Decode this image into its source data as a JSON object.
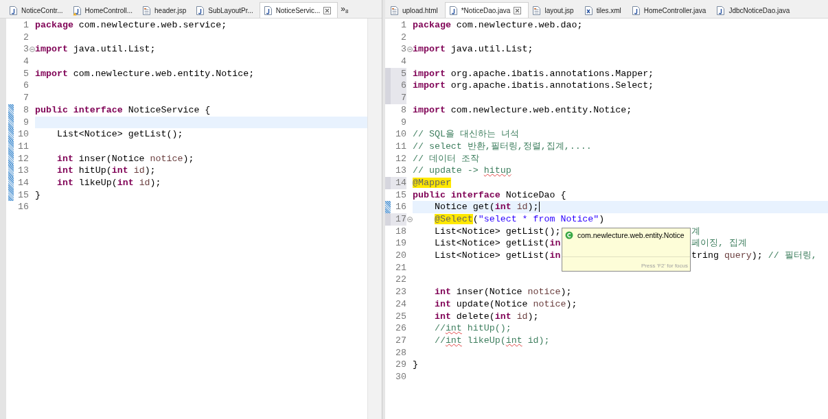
{
  "editors": [
    {
      "tabs": [
        {
          "label": "NoticeContr...",
          "kind": "java",
          "selected": false
        },
        {
          "label": "HomeControll...",
          "kind": "java-warning",
          "selected": false
        },
        {
          "label": "header.jsp",
          "kind": "web",
          "selected": false
        },
        {
          "label": "SubLayoutPr...",
          "kind": "java",
          "selected": false
        },
        {
          "label": "NoticeServic...",
          "kind": "java",
          "selected": true
        }
      ],
      "overflow": {
        "label": "»",
        "count": "8"
      },
      "lines": [
        {
          "number": "1",
          "tokens": [
            {
              "kind": "keyword",
              "text": "package "
            },
            {
              "kind": "plain",
              "text": "com.newlecture.web.service;"
            }
          ]
        },
        {
          "number": "2"
        },
        {
          "number": "3",
          "fold": true,
          "tokens": [
            {
              "kind": "keyword",
              "text": "import "
            },
            {
              "kind": "plain",
              "text": "java.util.List;"
            }
          ]
        },
        {
          "number": "4"
        },
        {
          "number": "5",
          "tokens": [
            {
              "kind": "keyword",
              "text": "import "
            },
            {
              "kind": "plain",
              "text": "com.newlecture.web.entity.Notice;"
            }
          ]
        },
        {
          "number": "6"
        },
        {
          "number": "7"
        },
        {
          "number": "8",
          "added": true,
          "tokens": [
            {
              "kind": "keyword",
              "text": "public interface "
            },
            {
              "kind": "plain",
              "text": "NoticeService {"
            }
          ]
        },
        {
          "number": "9",
          "added": true,
          "current": true
        },
        {
          "number": "10",
          "added": true,
          "tokens": [
            {
              "kind": "plain",
              "text": "    List<Notice> getList();"
            }
          ]
        },
        {
          "number": "11",
          "added": true
        },
        {
          "number": "12",
          "added": true,
          "tokens": [
            {
              "kind": "keyword",
              "text": "    int "
            },
            {
              "kind": "plain",
              "text": "inser(Notice "
            },
            {
              "kind": "param",
              "text": "notice"
            },
            {
              "kind": "plain",
              "text": ");"
            }
          ]
        },
        {
          "number": "13",
          "added": true,
          "tokens": [
            {
              "kind": "keyword",
              "text": "    int "
            },
            {
              "kind": "plain",
              "text": "hitUp("
            },
            {
              "kind": "keyword",
              "text": "int "
            },
            {
              "kind": "param",
              "text": "id"
            },
            {
              "kind": "plain",
              "text": ");"
            }
          ]
        },
        {
          "number": "14",
          "added": true,
          "tokens": [
            {
              "kind": "keyword",
              "text": "    int "
            },
            {
              "kind": "plain",
              "text": "likeUp("
            },
            {
              "kind": "keyword",
              "text": "int "
            },
            {
              "kind": "param",
              "text": "id"
            },
            {
              "kind": "plain",
              "text": ");"
            }
          ]
        },
        {
          "number": "15",
          "added": true,
          "tokens": [
            {
              "kind": "plain",
              "text": "}"
            }
          ]
        },
        {
          "number": "16"
        }
      ]
    },
    {
      "tabs": [
        {
          "label": "upload.html",
          "kind": "web",
          "selected": false
        },
        {
          "label": "*NoticeDao.java",
          "kind": "java",
          "selected": true
        },
        {
          "label": "layout.jsp",
          "kind": "web",
          "selected": false
        },
        {
          "label": "tiles.xml",
          "kind": "xml",
          "selected": false
        },
        {
          "label": "HomeController.java",
          "kind": "java",
          "selected": false
        },
        {
          "label": "JdbcNoticeDao.java",
          "kind": "java",
          "selected": false
        }
      ],
      "lines": [
        {
          "number": "1",
          "tokens": [
            {
              "kind": "keyword",
              "text": "package "
            },
            {
              "kind": "plain",
              "text": "com.newlecture.web.dao;"
            }
          ]
        },
        {
          "number": "2"
        },
        {
          "number": "3",
          "fold": true,
          "tokens": [
            {
              "kind": "keyword",
              "text": "import "
            },
            {
              "kind": "plain",
              "text": "java.util.List;"
            }
          ]
        },
        {
          "number": "4"
        },
        {
          "number": "5",
          "modified": true,
          "tokens": [
            {
              "kind": "keyword",
              "text": "import "
            },
            {
              "kind": "plain",
              "text": "org.apache.ibatis.annotations.Mapper;"
            }
          ]
        },
        {
          "number": "6",
          "modified": true,
          "tokens": [
            {
              "kind": "keyword",
              "text": "import "
            },
            {
              "kind": "plain",
              "text": "org.apache.ibatis.annotations.Select;"
            }
          ]
        },
        {
          "number": "7",
          "modified": true
        },
        {
          "number": "8",
          "tokens": [
            {
              "kind": "keyword",
              "text": "import "
            },
            {
              "kind": "plain",
              "text": "com.newlecture.web.entity.Notice;"
            }
          ]
        },
        {
          "number": "9"
        },
        {
          "number": "10",
          "tokens": [
            {
              "kind": "comment",
              "text": "// SQL을 대신하는 녀석"
            }
          ]
        },
        {
          "number": "11",
          "tokens": [
            {
              "kind": "comment",
              "text": "// select 반환,필터링,정렬,집계,...."
            }
          ]
        },
        {
          "number": "12",
          "tokens": [
            {
              "kind": "comment",
              "text": "// 데이터 조작"
            }
          ]
        },
        {
          "number": "13",
          "tokens": [
            {
              "kind": "comment",
              "text": "// update -> "
            },
            {
              "kind": "comment",
              "text": "hitup",
              "misspelled": true
            }
          ]
        },
        {
          "number": "14",
          "modified": true,
          "tokens": [
            {
              "kind": "annotation",
              "text": "@Mapper",
              "marked": true
            }
          ]
        },
        {
          "number": "15",
          "tokens": [
            {
              "kind": "keyword",
              "text": "public interface "
            },
            {
              "kind": "plain",
              "text": "NoticeDao {"
            }
          ]
        },
        {
          "number": "16",
          "added": true,
          "current": true,
          "caret": true,
          "tokens": [
            {
              "kind": "plain",
              "text": "    Notice get("
            },
            {
              "kind": "keyword",
              "text": "int "
            },
            {
              "kind": "param",
              "text": "id"
            },
            {
              "kind": "plain",
              "text": ");"
            }
          ]
        },
        {
          "number": "17",
          "modified": true,
          "fold": true,
          "tokens": [
            {
              "kind": "annotation",
              "text": "    @Select",
              "marked": true
            },
            {
              "kind": "plain",
              "text": "("
            },
            {
              "kind": "string",
              "text": "\"select * from Notice\""
            },
            {
              "kind": "plain",
              "text": ")"
            }
          ]
        },
        {
          "number": "18",
          "tokens": [
            {
              "kind": "plain",
              "text": "    List<Notice> getList();"
            }
          ],
          "tail": [
            {
              "kind": "comment",
              "text": "계"
            }
          ]
        },
        {
          "number": "19",
          "tokens": [
            {
              "kind": "plain",
              "text": "    List<Notice> getList("
            },
            {
              "kind": "keyword",
              "text": "in"
            }
          ],
          "tail": [
            {
              "kind": "comment",
              "text": "페이징, 집계"
            }
          ]
        },
        {
          "number": "20",
          "tokens": [
            {
              "kind": "plain",
              "text": "    List<Notice> getList("
            },
            {
              "kind": "keyword",
              "text": "in"
            }
          ],
          "tail": [
            {
              "kind": "plain",
              "text": "tring "
            },
            {
              "kind": "param",
              "text": "query"
            },
            {
              "kind": "plain",
              "text": "); "
            },
            {
              "kind": "comment",
              "text": "// 필터링,"
            }
          ]
        },
        {
          "number": "21"
        },
        {
          "number": "22"
        },
        {
          "number": "23",
          "tokens": [
            {
              "kind": "keyword",
              "text": "    int "
            },
            {
              "kind": "plain",
              "text": "inser(Notice "
            },
            {
              "kind": "param",
              "text": "notice"
            },
            {
              "kind": "plain",
              "text": ");"
            }
          ]
        },
        {
          "number": "24",
          "tokens": [
            {
              "kind": "keyword",
              "text": "    int "
            },
            {
              "kind": "plain",
              "text": "update(Notice "
            },
            {
              "kind": "param",
              "text": "notice"
            },
            {
              "kind": "plain",
              "text": ");"
            }
          ]
        },
        {
          "number": "25",
          "tokens": [
            {
              "kind": "keyword",
              "text": "    int "
            },
            {
              "kind": "plain",
              "text": "delete("
            },
            {
              "kind": "keyword",
              "text": "int "
            },
            {
              "kind": "param",
              "text": "id"
            },
            {
              "kind": "plain",
              "text": ");"
            }
          ]
        },
        {
          "number": "26",
          "tokens": [
            {
              "kind": "comment",
              "text": "    //"
            },
            {
              "kind": "comment",
              "text": "int",
              "misspelled": true
            },
            {
              "kind": "comment",
              "text": " hitUp();"
            }
          ]
        },
        {
          "number": "27",
          "tokens": [
            {
              "kind": "comment",
              "text": "    //"
            },
            {
              "kind": "comment",
              "text": "int",
              "misspelled": true
            },
            {
              "kind": "comment",
              "text": " likeUp("
            },
            {
              "kind": "comment",
              "text": "int",
              "misspelled": true
            },
            {
              "kind": "comment",
              "text": " id);"
            }
          ]
        },
        {
          "number": "28"
        },
        {
          "number": "29",
          "tokens": [
            {
              "kind": "plain",
              "text": "}"
            }
          ]
        },
        {
          "number": "30"
        }
      ],
      "popup": {
        "title": "com.newlecture.web.entity.Notice",
        "hint": "Press 'F2' for focus"
      }
    }
  ]
}
